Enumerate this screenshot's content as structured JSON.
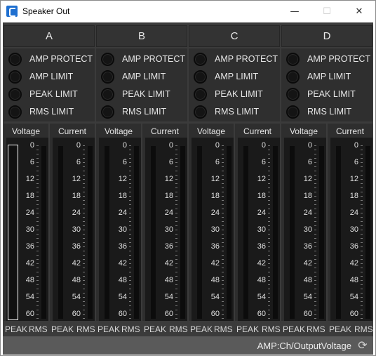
{
  "window": {
    "title": "Speaker Out",
    "minimize_glyph": "—",
    "maximize_glyph": "☐",
    "close_glyph": "✕"
  },
  "indicator_labels": [
    "AMP PROTECT",
    "AMP LIMIT",
    "PEAK LIMIT",
    "RMS LIMIT"
  ],
  "meter_titles": {
    "voltage": "Voltage",
    "current": "Current"
  },
  "scale": [
    "0",
    "6",
    "12",
    "18",
    "24",
    "30",
    "36",
    "42",
    "48",
    "54",
    "60"
  ],
  "footer_labels": {
    "peak": "PEAK",
    "rms": "RMS"
  },
  "channels": [
    {
      "name": "A",
      "selected_meter": "voltage"
    },
    {
      "name": "B",
      "selected_meter": ""
    },
    {
      "name": "C",
      "selected_meter": ""
    },
    {
      "name": "D",
      "selected_meter": ""
    }
  ],
  "status": {
    "parameter": "AMP:Ch/OutputVoltage",
    "refresh_icon": "refresh-icon"
  },
  "colors": {
    "panel": "#3b3b3b",
    "led_off": "#141414",
    "status_bar": "#5a5a5a"
  }
}
